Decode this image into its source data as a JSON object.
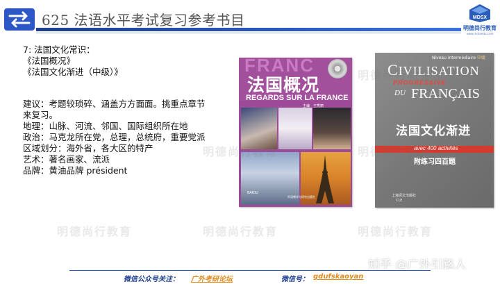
{
  "header": {
    "title": "625 法语水平考试复习参考书目",
    "logo": {
      "mark": "MDSX",
      "name": "明德尚行教育",
      "sub": "www.mdsxedu.com"
    }
  },
  "content": {
    "lines_top": [
      "7: 法国文化常识：",
      "《法国概况》",
      "《法国文化渐进（中级）》"
    ],
    "lines_bottom": [
      "建议：考题较琐碎、涵盖方方面面。挑重点章节",
      "来复习。",
      "地理：山脉、河流、邻国、国际组织所在地",
      "政治：马克龙所在党，总理，总统府，重要党派",
      "区域划分：海外省，各大区的特产",
      "艺术：著名画家、流派",
      "品牌：黄油品牌 président"
    ]
  },
  "book1": {
    "ghost": "FRANC",
    "title": "法国概况",
    "subtitle": "REGARDS SUR LA FRANCE",
    "author": "主编　王秀丽",
    "publisher": "BAIDU",
    "publisher2": "外语教学与研究出版社"
  },
  "book2": {
    "level_fr": "Niveau intermédiaire",
    "level_cn": "中级",
    "civ_initial": "C",
    "civ_rest": "IVILISATION",
    "progressive": "PROGRESSIVE",
    "du": "DU",
    "francais": "FRANÇAIS",
    "title": "法国文化渐进",
    "activities": "avec 400 activités",
    "exercises": "附练习四百题",
    "publisher": "上海译文出版社",
    "publisher2": "CLE"
  },
  "watermarks": {
    "text": "明德尚行教育"
  },
  "zhihu": "知乎 @广外引路人",
  "footer": {
    "wechat_label": "微信公众号关注：",
    "wechat_value": "广外考研论坛",
    "id_label": "微信号：",
    "id_value": "gdufskaoyan"
  },
  "colors": {
    "accent": "#2b58c4",
    "book1": "#9d4a98",
    "book2": "#7a7a7a",
    "footer_link": "#e08a1a"
  }
}
